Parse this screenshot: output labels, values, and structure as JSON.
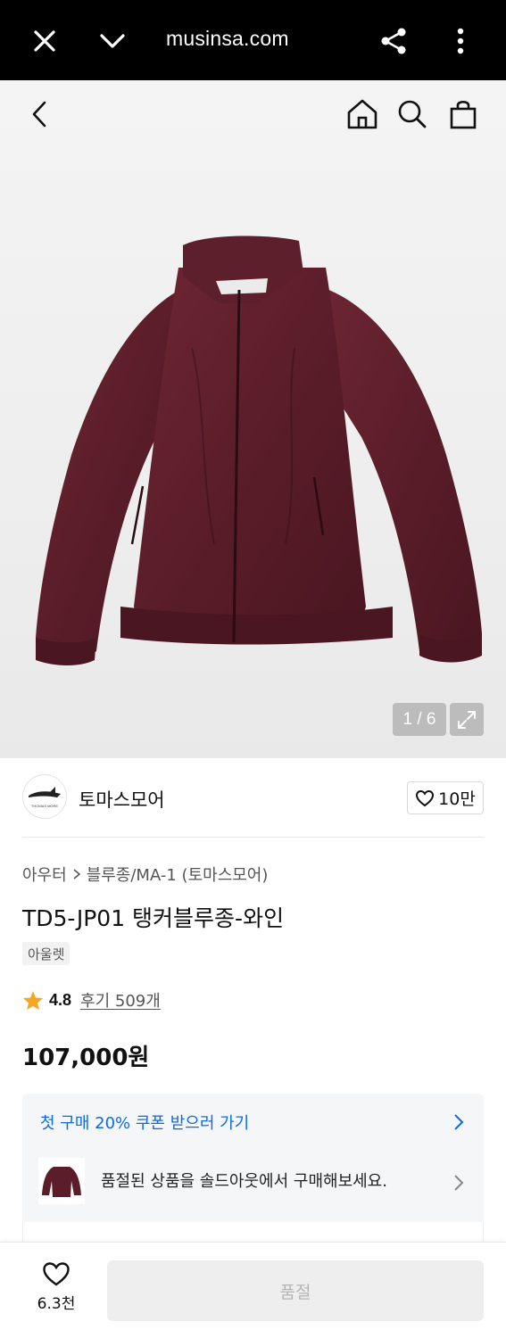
{
  "browser": {
    "url": "musinsa.com"
  },
  "gallery": {
    "counter": "1 / 6"
  },
  "brand": {
    "name": "토마스모어",
    "logo_text": "THOMAS MORE",
    "like_count": "10만"
  },
  "breadcrumb": {
    "level1": "아우터",
    "level2": "블루종/MA-1 (토마스모어)"
  },
  "product": {
    "title": "TD5-JP01 탱커블루종-와인",
    "badge": "아울렛",
    "rating": "4.8",
    "reviews": "후기 509개",
    "price": "107,000원",
    "color": "#5a1f2b"
  },
  "promo": {
    "coupon_text": "첫 구매 20% 쿠폰 받으러 가기",
    "soldout_text": "품절된 상품을 솔드아웃에서 구매해보세요."
  },
  "bottom": {
    "wish_count": "6.3천",
    "buy_label": "품절"
  },
  "colors": {
    "accent_blue": "#0c6be0",
    "star": "#f5a623"
  }
}
